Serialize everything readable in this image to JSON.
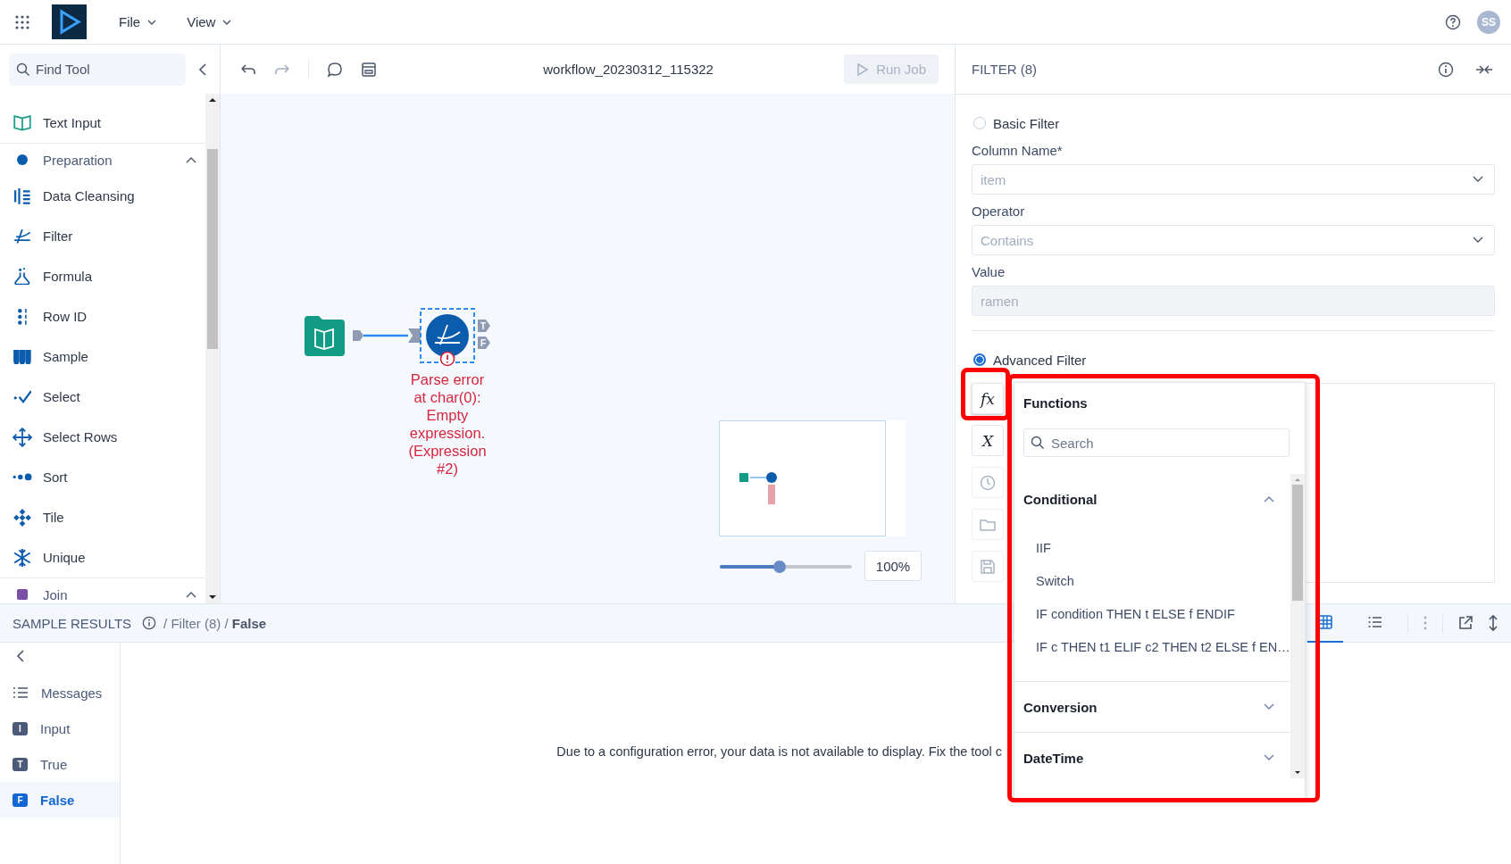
{
  "top_bar": {
    "menus": [
      {
        "label": "File"
      },
      {
        "label": "View"
      }
    ],
    "avatar": "SS"
  },
  "sidebar": {
    "search": {
      "placeholder": "Find Tool"
    },
    "items": [
      {
        "kind": "tool",
        "label": "Text Input"
      },
      {
        "kind": "category",
        "label": "Preparation",
        "expanded": true,
        "color": "#0b5cad"
      },
      {
        "kind": "tool",
        "label": "Data Cleansing"
      },
      {
        "kind": "tool",
        "label": "Filter"
      },
      {
        "kind": "tool",
        "label": "Formula"
      },
      {
        "kind": "tool",
        "label": "Row ID"
      },
      {
        "kind": "tool",
        "label": "Sample"
      },
      {
        "kind": "tool",
        "label": "Select"
      },
      {
        "kind": "tool",
        "label": "Select Rows"
      },
      {
        "kind": "tool",
        "label": "Sort"
      },
      {
        "kind": "tool",
        "label": "Tile"
      },
      {
        "kind": "tool",
        "label": "Unique"
      },
      {
        "kind": "category",
        "label": "Join",
        "expanded": true,
        "color": "#7b4fa8"
      }
    ]
  },
  "toolbar": {
    "workflow_title": "workflow_20230312_115322",
    "run_button": {
      "label": "Run Job",
      "disabled": true
    }
  },
  "canvas": {
    "ports": [
      "T",
      "F"
    ],
    "error_message": "Parse error at char(0): Empty expression. (Expression #2)",
    "zoom": {
      "level": 0.45,
      "reading": "100%"
    }
  },
  "config_panel": {
    "title": "FILTER (8)",
    "basic_filter": {
      "label": "Basic Filter",
      "selected": false
    },
    "fields": [
      {
        "kind": "select",
        "label": "Column Name*",
        "value": "item"
      },
      {
        "kind": "select",
        "label": "Operator",
        "value": "Contains"
      },
      {
        "kind": "text",
        "label": "Value",
        "value": "ramen"
      }
    ],
    "advanced_filter": {
      "label": "Advanced Filter",
      "selected": true
    },
    "editor_tools": [
      {
        "kind": "text",
        "label": "fx",
        "selected": true,
        "disabled": false
      },
      {
        "kind": "text",
        "label": "X",
        "selected": false,
        "disabled": false
      },
      {
        "kind": "clock",
        "selected": false,
        "disabled": true
      },
      {
        "kind": "folder",
        "selected": false,
        "disabled": true
      },
      {
        "kind": "save",
        "selected": false,
        "disabled": true
      }
    ]
  },
  "functions_popup": {
    "title": "Functions",
    "search": {
      "placeholder": "Search"
    },
    "groups": [
      {
        "label": "Conditional",
        "expanded": true,
        "items": [
          "IIF",
          "Switch",
          "IF condition THEN t ELSE f ENDIF",
          "IF c THEN t1 ELIF c2 THEN t2 ELSE f EN…"
        ]
      },
      {
        "label": "Conversion",
        "expanded": false
      },
      {
        "label": "DateTime",
        "expanded": false
      }
    ]
  },
  "sample_results": {
    "title": "SAMPLE RESULTS",
    "breadcrumb": "/ Filter (8) / **False**",
    "nav": [
      {
        "kind": "list",
        "label": "Messages",
        "selected": false
      },
      {
        "kind": "badge",
        "badge": "I",
        "label": "Input",
        "selected": false
      },
      {
        "kind": "badge",
        "badge": "T",
        "label": "True",
        "selected": false
      },
      {
        "kind": "badge",
        "badge": "F",
        "label": "False",
        "selected": true
      }
    ],
    "message": "Due to a configuration error, your data is not available to display. Fix the tool c",
    "views": [
      {
        "kind": "grid",
        "selected": true
      },
      {
        "kind": "list",
        "selected": false
      }
    ]
  }
}
